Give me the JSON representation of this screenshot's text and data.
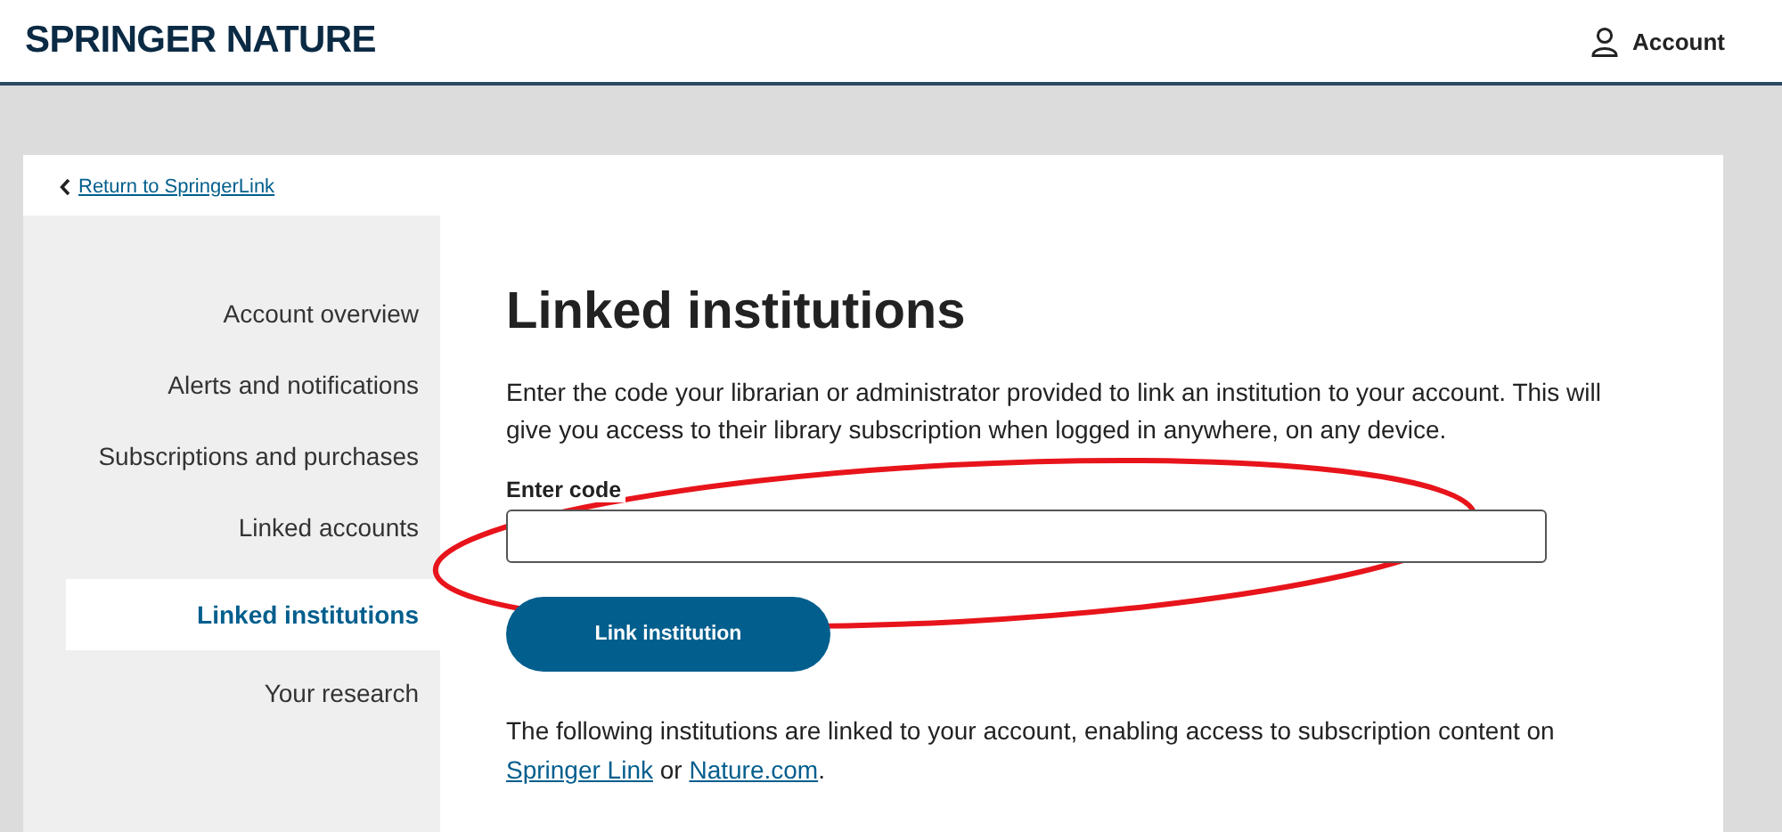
{
  "header": {
    "logo": "SPRINGER NATURE",
    "account": "Account"
  },
  "back_link": "Return to SpringerLink",
  "sidebar": {
    "items": [
      {
        "label": "Account overview",
        "selected": false
      },
      {
        "label": "Alerts and notifications",
        "selected": false
      },
      {
        "label": "Subscriptions and purchases",
        "selected": false
      },
      {
        "label": "Linked accounts",
        "selected": false
      },
      {
        "label": "Linked institutions",
        "selected": true
      },
      {
        "label": "Your research",
        "selected": false
      }
    ]
  },
  "main": {
    "title": "Linked institutions",
    "intro": "Enter the code your librarian or administrator provided to link an institution to your account. This will give you access to their library subscription when logged in anywhere, on any device.",
    "field": {
      "label": "Enter code"
    },
    "button": "Link institution",
    "note": [
      {
        "kind": "text",
        "text": "The following institutions are linked to your account, enabling access to subscription content on "
      },
      {
        "kind": "link",
        "text": "Springer Link"
      },
      {
        "kind": "text",
        "text": " or "
      },
      {
        "kind": "link",
        "text": "Nature.com"
      },
      {
        "kind": "text",
        "text": "."
      }
    ]
  }
}
